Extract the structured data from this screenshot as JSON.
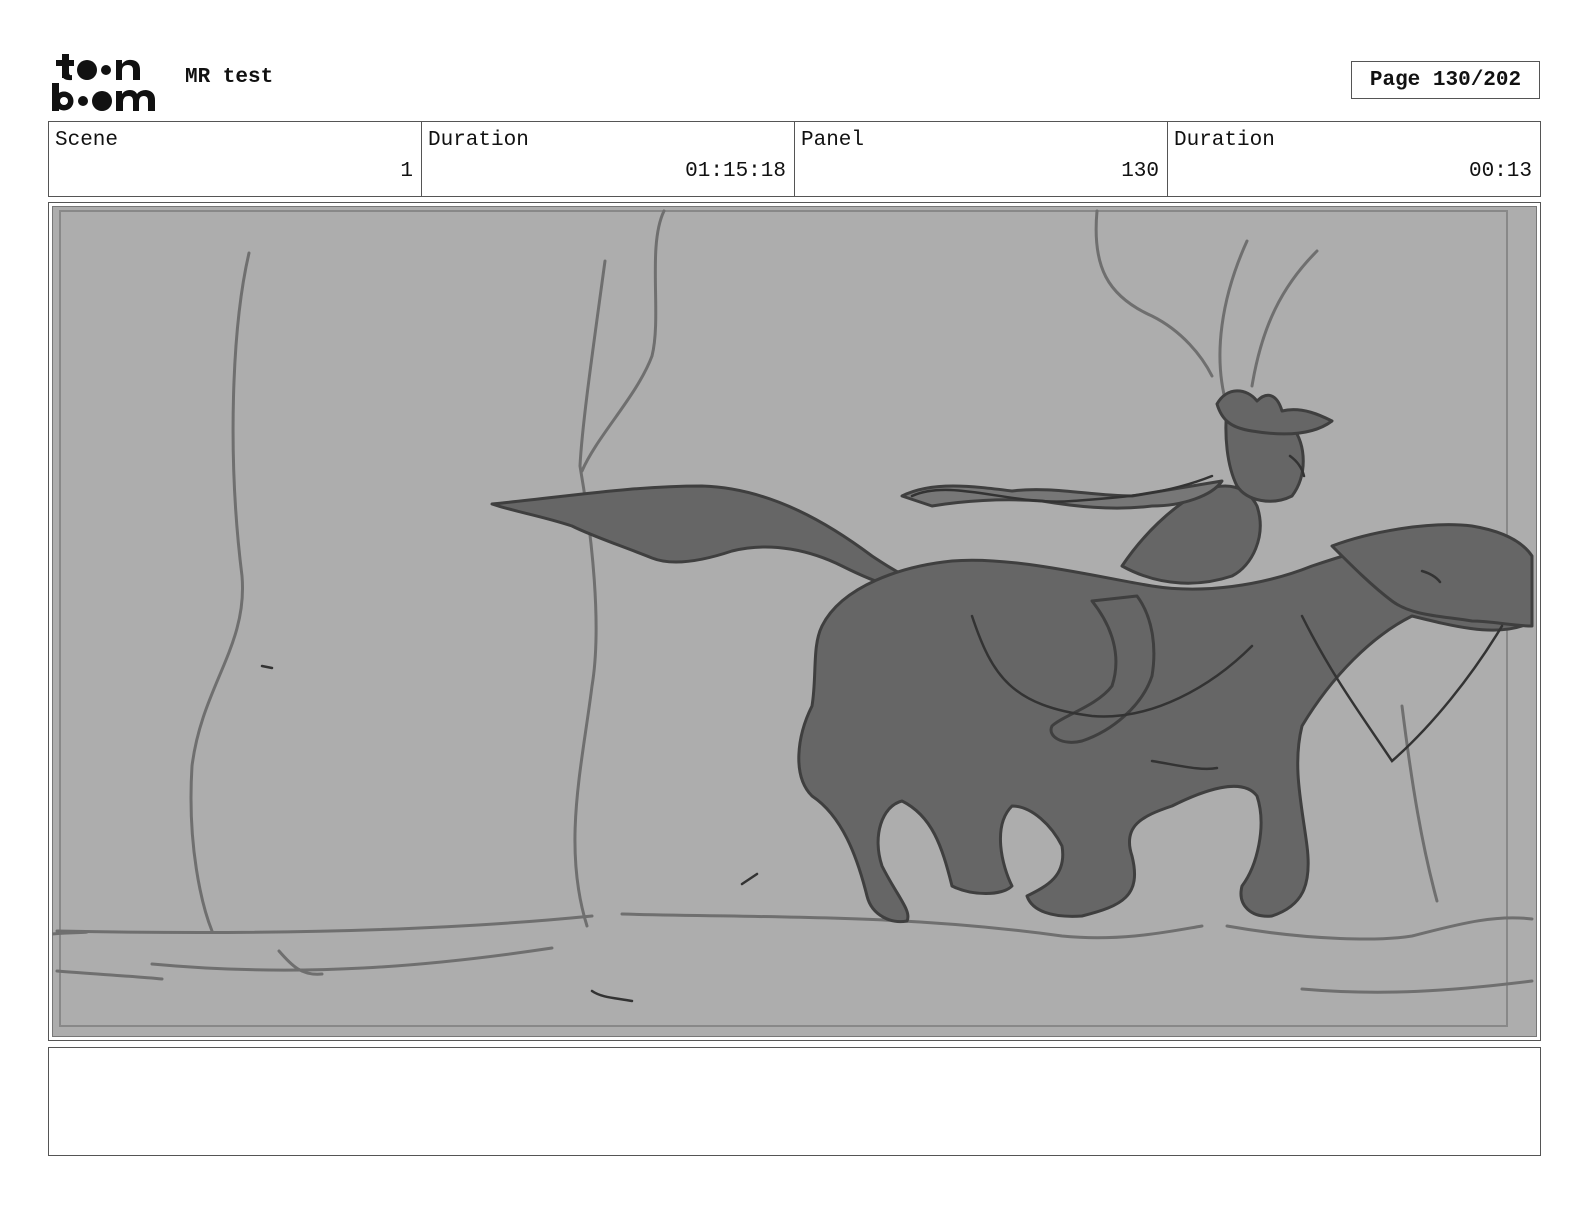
{
  "header": {
    "logo_text_top": "toon",
    "logo_text_bottom": "boom",
    "project_title": "MR test",
    "page_label": "Page 130/202"
  },
  "info": {
    "scene_label": "Scene",
    "scene_value": "1",
    "scene_duration_label": "Duration",
    "scene_duration_value": "01:15:18",
    "panel_label": "Panel",
    "panel_value": "130",
    "panel_duration_label": "Duration",
    "panel_duration_value": "00:13"
  },
  "panel": {
    "image_icon": "storyboard-sketch-rider-on-horse",
    "background_color": "#adadad",
    "sketch_fill_color": "#666666",
    "line_color": "#444444"
  },
  "notes": {
    "text": ""
  }
}
